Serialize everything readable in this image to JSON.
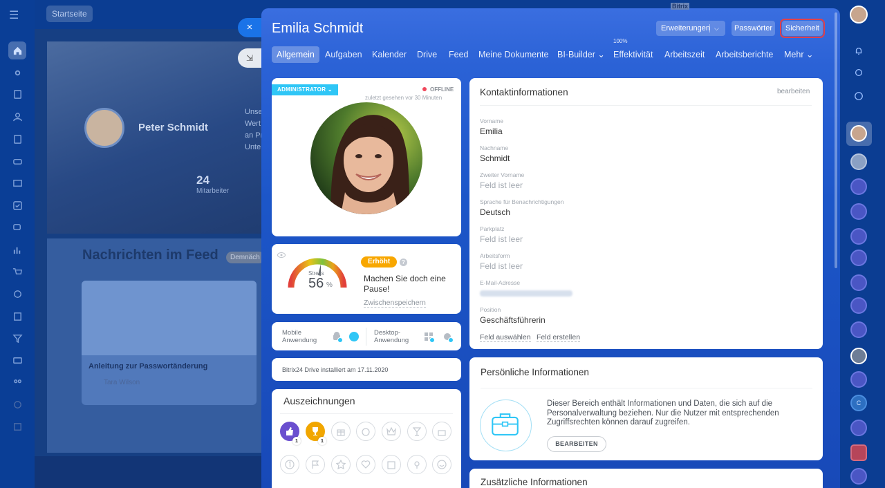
{
  "background": {
    "home_button": "Startseite",
    "profile_name": "Peter Schmidt",
    "intro_text": "Unse Wert an Pr Unte",
    "employee_count": "24",
    "employee_label": "Mitarbeiter",
    "feed_title": "Nachrichten im Feed",
    "feed_badge": "Demnäch",
    "post_title": "Anleitung zur Passwortänderung",
    "post_author": "Tara Wilson"
  },
  "slider": {
    "close_icon": "×",
    "collapse_icon": "⇲",
    "bitrix_tag": "Bitrix",
    "title": "Emilia Schmidt",
    "buttons": {
      "extensions": "Erweiterungen",
      "passwords": "Passwörter",
      "security": "Sicherheit"
    },
    "tabs": [
      {
        "label": "Allgemein",
        "active": true
      },
      {
        "label": "Aufgaben"
      },
      {
        "label": "Kalender"
      },
      {
        "label": "Drive"
      },
      {
        "label": "Feed"
      },
      {
        "label": "Meine Dokumente"
      },
      {
        "label": "BI-Builder ⌄"
      },
      {
        "label": "Effektivität",
        "sup": "100%"
      },
      {
        "label": "Arbeitszeit"
      },
      {
        "label": "Arbeitsberichte"
      },
      {
        "label": "Mehr ⌄"
      }
    ]
  },
  "profile": {
    "role_badge": "ADMINISTRATOR",
    "status": "OFFLINE",
    "last_seen": "zuletzt gesehen vor 30 Minuten"
  },
  "stress": {
    "label": "Stress",
    "value": "56",
    "unit": "%",
    "level": "Erhöht",
    "message": "Machen Sie doch eine Pause!",
    "save_link": "Zwischenspeichern"
  },
  "apps": {
    "mobile": "Mobile Anwendung",
    "desktop": "Desktop-Anwendung"
  },
  "drive_info": "Bitrix24 Drive installiert am 17.11.2020",
  "awards": {
    "title": "Auszeichnungen",
    "like_count": "1",
    "cup_count": "1",
    "icons": [
      "thumbs-up-icon",
      "trophy-icon",
      "gift-icon",
      "money-bag-icon",
      "crown-icon",
      "cocktail-icon",
      "cake-icon",
      "number-one-icon",
      "flag-icon",
      "star-icon",
      "heart-icon",
      "calendar-icon",
      "flower-icon",
      "smile-icon"
    ]
  },
  "contact": {
    "title": "Kontaktinformationen",
    "edit": "bearbeiten",
    "fields": [
      {
        "label": "Vorname",
        "value": "Emilia"
      },
      {
        "label": "Nachname",
        "value": "Schmidt"
      },
      {
        "label": "Zweiter Vorname",
        "value": "Feld ist leer"
      },
      {
        "label": "Sprache für Benachrichtigungen",
        "value": "Deutsch"
      },
      {
        "label": "Parkplatz",
        "value": "Feld ist leer"
      },
      {
        "label": "Arbeitsform",
        "value": "Feld ist leer"
      },
      {
        "label": "E-Mail-Adresse",
        "value": ""
      },
      {
        "label": "Position",
        "value": "Geschäftsführerin"
      }
    ],
    "select_field": "Feld auswählen",
    "create_field": "Feld erstellen"
  },
  "personal": {
    "title": "Persönliche Informationen",
    "text": "Dieser Bereich enthält Informationen und Daten, die sich auf die Personalverwaltung beziehen. Nur die Nutzer mit entsprechenden Zugriffsrechten können darauf zugreifen.",
    "button": "BEARBEITEN"
  },
  "additional": {
    "title": "Zusätzliche Informationen"
  },
  "right_rail": {
    "contact_initial": "C"
  },
  "colors": {
    "accent": "#2fc6f6",
    "slider_blue": "#1c56c8",
    "badge_orange": "#f8a700",
    "offline_red": "#f0475b",
    "highlight_red": "#e0414b"
  }
}
